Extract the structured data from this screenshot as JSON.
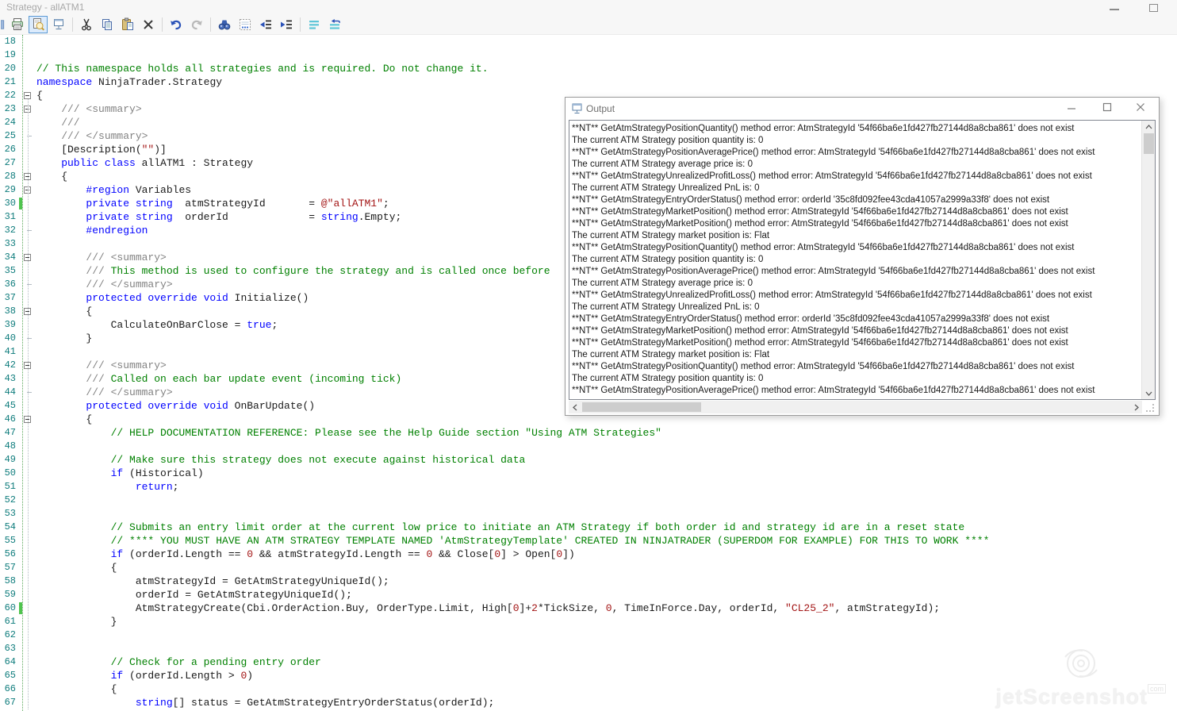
{
  "window": {
    "title": "Strategy - allATM1"
  },
  "toolbar": {
    "icons": [
      {
        "name": "clipped-icon"
      },
      {
        "name": "print-icon"
      },
      {
        "name": "print-preview-icon",
        "selected": true
      },
      {
        "name": "output-window-icon"
      },
      {
        "sep": true
      },
      {
        "name": "cut-icon"
      },
      {
        "name": "copy-icon"
      },
      {
        "name": "paste-icon"
      },
      {
        "name": "delete-icon"
      },
      {
        "sep": true
      },
      {
        "name": "undo-icon"
      },
      {
        "name": "redo-icon",
        "disabled": true
      },
      {
        "sep": true
      },
      {
        "name": "find-icon"
      },
      {
        "name": "whitespace-icon"
      },
      {
        "name": "outdent-icon"
      },
      {
        "name": "indent-icon"
      },
      {
        "sep": true
      },
      {
        "name": "comment-selection-icon"
      },
      {
        "name": "uncomment-selection-icon"
      }
    ]
  },
  "editor": {
    "first_line": 18,
    "lines": [
      {
        "n": 18,
        "segs": []
      },
      {
        "n": 19,
        "segs": []
      },
      {
        "n": 20,
        "segs": [
          [
            "c",
            "// This namespace holds all strategies and is required. Do not change it."
          ]
        ]
      },
      {
        "n": 21,
        "segs": [
          [
            "k",
            "namespace"
          ],
          [
            "t",
            " NinjaTrader.Strategy"
          ]
        ]
      },
      {
        "n": 22,
        "fold": "box",
        "segs": [
          [
            "t",
            "{"
          ]
        ]
      },
      {
        "n": 23,
        "fold": "box",
        "segs": [
          [
            "d",
            "    /// <summary>"
          ]
        ]
      },
      {
        "n": 24,
        "segs": [
          [
            "d",
            "    ///"
          ]
        ]
      },
      {
        "n": 25,
        "fold": "end",
        "segs": [
          [
            "d",
            "    /// </summary>"
          ]
        ]
      },
      {
        "n": 26,
        "segs": [
          [
            "t",
            "    [Description("
          ],
          [
            "s",
            "\"\""
          ],
          [
            "t",
            ")]"
          ]
        ]
      },
      {
        "n": 27,
        "segs": [
          [
            "k",
            "    public class"
          ],
          [
            "t",
            " allATM1 : Strategy"
          ]
        ]
      },
      {
        "n": 28,
        "fold": "box",
        "segs": [
          [
            "t",
            "    {"
          ]
        ]
      },
      {
        "n": 29,
        "fold": "box",
        "segs": [
          [
            "k",
            "        #region"
          ],
          [
            "t",
            " Variables"
          ]
        ]
      },
      {
        "n": 30,
        "chg": true,
        "segs": [
          [
            "k",
            "        private string"
          ],
          [
            "t",
            "  atmStrategyId       = "
          ],
          [
            "s",
            "@\"allATM1\""
          ],
          [
            "t",
            ";"
          ]
        ]
      },
      {
        "n": 31,
        "segs": [
          [
            "k",
            "        private string"
          ],
          [
            "t",
            "  orderId             = "
          ],
          [
            "k",
            "string"
          ],
          [
            "t",
            ".Empty;"
          ]
        ]
      },
      {
        "n": 32,
        "fold": "end",
        "segs": [
          [
            "k",
            "        #endregion"
          ]
        ]
      },
      {
        "n": 33,
        "segs": []
      },
      {
        "n": 34,
        "fold": "box",
        "segs": [
          [
            "d",
            "        /// <summary>"
          ]
        ]
      },
      {
        "n": 35,
        "segs": [
          [
            "d",
            "        /// "
          ],
          [
            "c",
            "This method is used to configure the strategy and is called once before"
          ]
        ]
      },
      {
        "n": 36,
        "fold": "end",
        "segs": [
          [
            "d",
            "        /// </summary>"
          ]
        ]
      },
      {
        "n": 37,
        "segs": [
          [
            "k",
            "        protected override void"
          ],
          [
            "t",
            " Initialize()"
          ]
        ]
      },
      {
        "n": 38,
        "fold": "box",
        "segs": [
          [
            "t",
            "        {"
          ]
        ]
      },
      {
        "n": 39,
        "segs": [
          [
            "t",
            "            CalculateOnBarClose = "
          ],
          [
            "k",
            "true"
          ],
          [
            "t",
            ";"
          ]
        ]
      },
      {
        "n": 40,
        "fold": "end",
        "segs": [
          [
            "t",
            "        }"
          ]
        ]
      },
      {
        "n": 41,
        "segs": []
      },
      {
        "n": 42,
        "fold": "box",
        "segs": [
          [
            "d",
            "        /// <summary>"
          ]
        ]
      },
      {
        "n": 43,
        "segs": [
          [
            "d",
            "        /// "
          ],
          [
            "c",
            "Called on each bar update event (incoming tick)"
          ]
        ]
      },
      {
        "n": 44,
        "fold": "end",
        "segs": [
          [
            "d",
            "        /// </summary>"
          ]
        ]
      },
      {
        "n": 45,
        "segs": [
          [
            "k",
            "        protected override void"
          ],
          [
            "t",
            " OnBarUpdate()"
          ]
        ]
      },
      {
        "n": 46,
        "fold": "box",
        "segs": [
          [
            "t",
            "        {"
          ]
        ]
      },
      {
        "n": 47,
        "segs": [
          [
            "c",
            "            // HELP DOCUMENTATION REFERENCE: Please see the Help Guide section \"Using ATM Strategies\""
          ]
        ]
      },
      {
        "n": 48,
        "segs": []
      },
      {
        "n": 49,
        "segs": [
          [
            "c",
            "            // Make sure this strategy does not execute against historical data"
          ]
        ]
      },
      {
        "n": 50,
        "segs": [
          [
            "k",
            "            if"
          ],
          [
            "t",
            " (Historical)"
          ]
        ]
      },
      {
        "n": 51,
        "segs": [
          [
            "k",
            "                return"
          ],
          [
            "t",
            ";"
          ]
        ]
      },
      {
        "n": 52,
        "segs": []
      },
      {
        "n": 53,
        "segs": []
      },
      {
        "n": 54,
        "segs": [
          [
            "c",
            "            // Submits an entry limit order at the current low price to initiate an ATM Strategy if both order id and strategy id are in a reset state"
          ]
        ]
      },
      {
        "n": 55,
        "segs": [
          [
            "c",
            "            // **** YOU MUST HAVE AN ATM STRATEGY TEMPLATE NAMED 'AtmStrategyTemplate' CREATED IN NINJATRADER (SUPERDOM FOR EXAMPLE) FOR THIS TO WORK ****"
          ]
        ]
      },
      {
        "n": 56,
        "segs": [
          [
            "k",
            "            if"
          ],
          [
            "t",
            " (orderId.Length == "
          ],
          [
            "n",
            "0"
          ],
          [
            "t",
            " && atmStrategyId.Length == "
          ],
          [
            "n",
            "0"
          ],
          [
            "t",
            " && Close["
          ],
          [
            "n",
            "0"
          ],
          [
            "t",
            "] > Open["
          ],
          [
            "n",
            "0"
          ],
          [
            "t",
            "])"
          ]
        ]
      },
      {
        "n": 57,
        "segs": [
          [
            "t",
            "            {"
          ]
        ]
      },
      {
        "n": 58,
        "segs": [
          [
            "t",
            "                atmStrategyId = GetAtmStrategyUniqueId();"
          ]
        ]
      },
      {
        "n": 59,
        "segs": [
          [
            "t",
            "                orderId = GetAtmStrategyUniqueId();"
          ]
        ]
      },
      {
        "n": 60,
        "chg": true,
        "segs": [
          [
            "t",
            "                AtmStrategyCreate(Cbi.OrderAction.Buy, OrderType.Limit, High["
          ],
          [
            "n",
            "0"
          ],
          [
            "t",
            "]+"
          ],
          [
            "n",
            "2"
          ],
          [
            "t",
            "*TickSize, "
          ],
          [
            "n",
            "0"
          ],
          [
            "t",
            ", TimeInForce.Day, orderId, "
          ],
          [
            "s",
            "\"CL25_2\""
          ],
          [
            "t",
            ", atmStrategyId);"
          ]
        ]
      },
      {
        "n": 61,
        "segs": [
          [
            "t",
            "            }"
          ]
        ]
      },
      {
        "n": 62,
        "segs": []
      },
      {
        "n": 63,
        "segs": []
      },
      {
        "n": 64,
        "segs": [
          [
            "c",
            "            // Check for a pending entry order"
          ]
        ]
      },
      {
        "n": 65,
        "segs": [
          [
            "k",
            "            if"
          ],
          [
            "t",
            " (orderId.Length > "
          ],
          [
            "n",
            "0"
          ],
          [
            "t",
            ")"
          ]
        ]
      },
      {
        "n": 66,
        "segs": [
          [
            "t",
            "            {"
          ]
        ]
      },
      {
        "n": 67,
        "segs": [
          [
            "t",
            "                "
          ],
          [
            "k",
            "string"
          ],
          [
            "t",
            "[] status = GetAtmStrategyEntryOrderStatus(orderId);"
          ]
        ]
      }
    ]
  },
  "output": {
    "title": "Output",
    "lines": [
      "**NT** GetAtmStrategyPositionQuantity() method error: AtmStrategyId '54f66ba6e1fd427fb27144d8a8cba861' does not exist",
      "The current ATM Strategy position quantity is: 0",
      "**NT** GetAtmStrategyPositionAveragePrice() method error: AtmStrategyId '54f66ba6e1fd427fb27144d8a8cba861' does not exist",
      "The current ATM Strategy average price is: 0",
      "**NT** GetAtmStrategyUnrealizedProfitLoss() method error: AtmStrategyId '54f66ba6e1fd427fb27144d8a8cba861' does not exist",
      "The current ATM Strategy Unrealized PnL is: 0",
      "**NT** GetAtmStrategyEntryOrderStatus() method error: orderId '35c8fd092fee43cda41057a2999a33f8' does not exist",
      "**NT** GetAtmStrategyMarketPosition() method error: AtmStrategyId '54f66ba6e1fd427fb27144d8a8cba861' does not exist",
      "**NT** GetAtmStrategyMarketPosition() method error: AtmStrategyId '54f66ba6e1fd427fb27144d8a8cba861' does not exist",
      "The current ATM Strategy market position is: Flat",
      "**NT** GetAtmStrategyPositionQuantity() method error: AtmStrategyId '54f66ba6e1fd427fb27144d8a8cba861' does not exist",
      "The current ATM Strategy position quantity is: 0",
      "**NT** GetAtmStrategyPositionAveragePrice() method error: AtmStrategyId '54f66ba6e1fd427fb27144d8a8cba861' does not exist",
      "The current ATM Strategy average price is: 0",
      "**NT** GetAtmStrategyUnrealizedProfitLoss() method error: AtmStrategyId '54f66ba6e1fd427fb27144d8a8cba861' does not exist",
      "The current ATM Strategy Unrealized PnL is: 0",
      "**NT** GetAtmStrategyEntryOrderStatus() method error: orderId '35c8fd092fee43cda41057a2999a33f8' does not exist",
      "**NT** GetAtmStrategyMarketPosition() method error: AtmStrategyId '54f66ba6e1fd427fb27144d8a8cba861' does not exist",
      "**NT** GetAtmStrategyMarketPosition() method error: AtmStrategyId '54f66ba6e1fd427fb27144d8a8cba861' does not exist",
      "The current ATM Strategy market position is: Flat",
      "**NT** GetAtmStrategyPositionQuantity() method error: AtmStrategyId '54f66ba6e1fd427fb27144d8a8cba861' does not exist",
      "The current ATM Strategy position quantity is: 0",
      "**NT** GetAtmStrategyPositionAveragePrice() method error: AtmStrategyId '54f66ba6e1fd427fb27144d8a8cba861' does not exist"
    ]
  },
  "watermark": {
    "text": "jetScreenshot",
    "tld": "com"
  },
  "colors": {
    "keyword": "#0000ff",
    "comment": "#008000",
    "doc_comment": "#838383",
    "string_literal": "#a31515",
    "line_number": "#0e7c7c",
    "change_bar": "#4fc44f",
    "toolbar_selected_border": "#5c9ad4"
  }
}
